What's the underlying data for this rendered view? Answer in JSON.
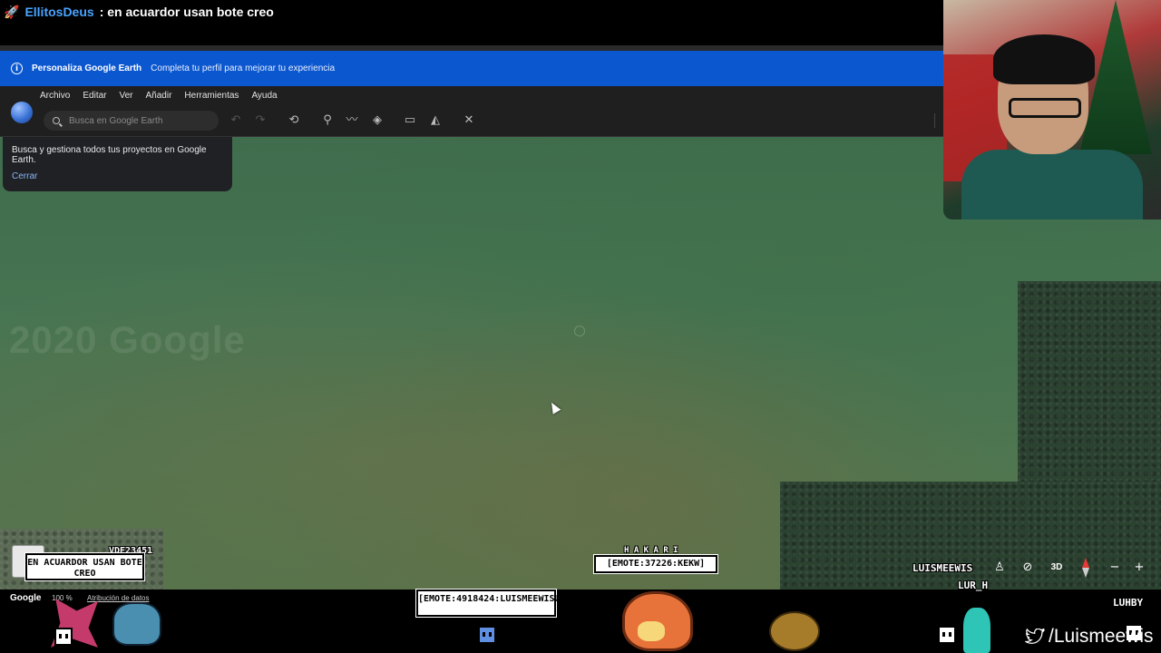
{
  "chat": {
    "username": "EllitosDeus",
    "message": ": en acuardor usan bote creo"
  },
  "banner": {
    "title": "Personaliza Google Earth",
    "text": "Completa tu perfil para mejorar tu experiencia"
  },
  "menu": {
    "items": [
      "Archivo",
      "Editar",
      "Ver",
      "Añadir",
      "Herramientas",
      "Ayuda"
    ]
  },
  "search": {
    "placeholder": "Busca en Google Earth"
  },
  "popup": {
    "text": "Busca y gestiona todos tus proyectos en Google Earth.",
    "close_label": "Cerrar"
  },
  "map": {
    "watermark": "2020 Google"
  },
  "map_controls": {
    "btn_3d": "3D"
  },
  "footer": {
    "google_label": "Google",
    "zoom": "100 %",
    "attribution": "Atribución de datos"
  },
  "overlays": {
    "speech_1": "EN ACUARDOR USAN BOTE CREO",
    "speech_2": "[EMOTE:37226:KEKW]",
    "speech_3": "[EMOTE:4918424:LUISMEEWISUPS]",
    "name_top_left": "VDE23451",
    "name_center": "H A K A R I",
    "name_right_1": "LUISMEEWIS",
    "name_right_2": "LUR_H",
    "name_far_right": "LUHBY",
    "twitter": "/Luismeewis"
  }
}
